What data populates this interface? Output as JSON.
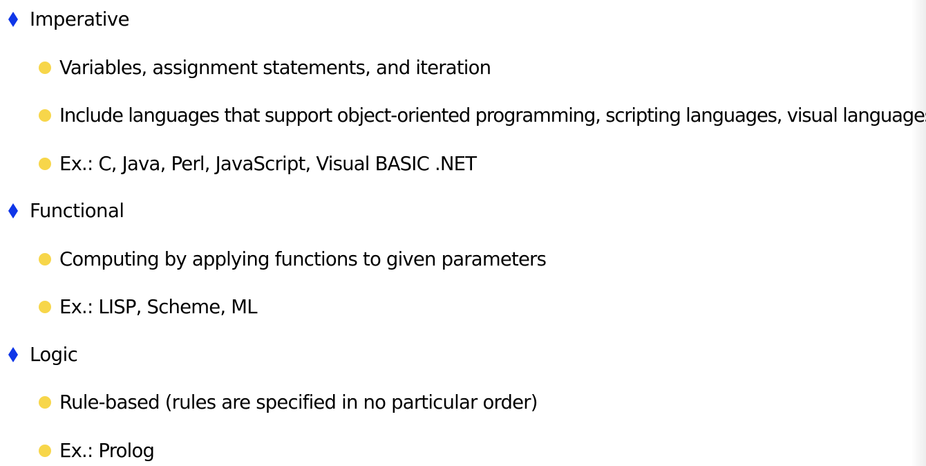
{
  "colors": {
    "level1_bullet": "#0f36e8",
    "level2_bullet": "#f7d64a",
    "text": "#000000",
    "background": "#ffffff"
  },
  "icons": {
    "level1_bullet": "blue-diamond-bullet-icon",
    "level2_bullet": "yellow-dot-bullet-icon"
  },
  "outline": [
    {
      "label": "Imperative",
      "items": [
        "Variables, assignment statements, and iteration",
        "Include languages that support object-oriented programming, scripting languages, visual languages",
        "Ex.: C, Java, Perl, JavaScript, Visual BASIC .NET"
      ]
    },
    {
      "label": "Functional",
      "items": [
        "Computing by applying functions to given parameters",
        "Ex.: LISP, Scheme, ML"
      ]
    },
    {
      "label": "Logic",
      "items": [
        "Rule-based (rules are specified in no particular order)",
        "Ex.: Prolog"
      ]
    }
  ]
}
